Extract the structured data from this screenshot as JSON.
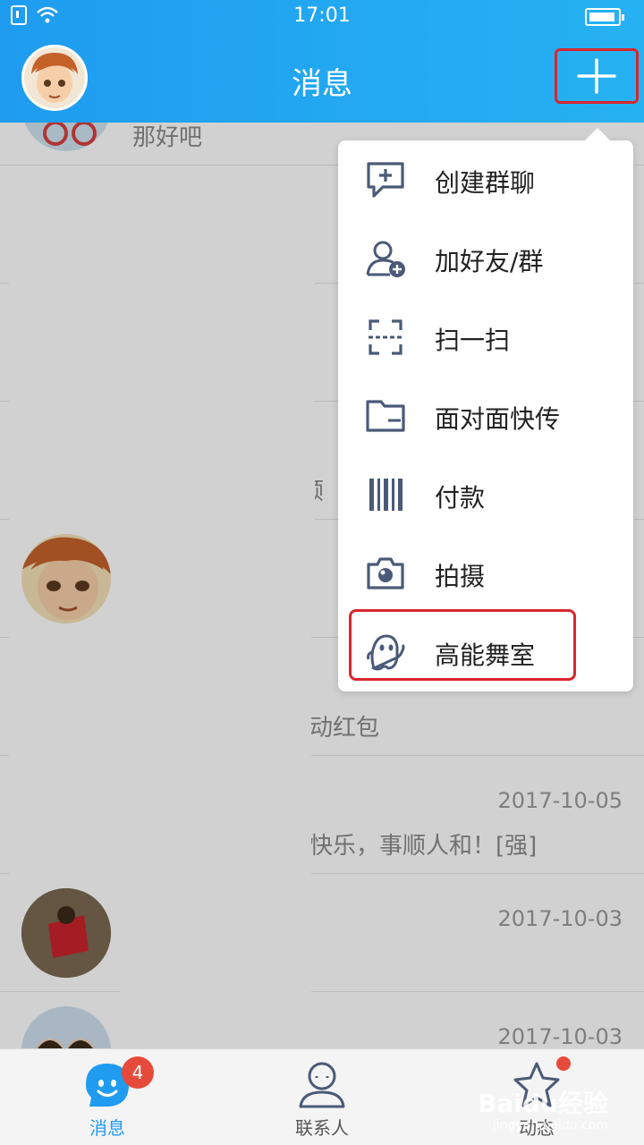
{
  "status_bar": {
    "time": "17:01"
  },
  "header": {
    "title": "消息",
    "add_icon": "plus-icon"
  },
  "rows": [
    {
      "msg": "那好吧"
    },
    {
      "msg": "顺"
    },
    {
      "msg": ""
    },
    {
      "msg": "动红包"
    },
    {
      "time": "2017-10-05",
      "msg": "快乐，事顺人和！[强]"
    },
    {
      "time": "2017-10-03"
    },
    {
      "time": "2017-10-03"
    }
  ],
  "menu": {
    "items": [
      {
        "label": "创建群聊",
        "icon": "group-chat-icon"
      },
      {
        "label": "加好友/群",
        "icon": "add-friend-icon"
      },
      {
        "label": "扫一扫",
        "icon": "scan-icon"
      },
      {
        "label": "面对面快传",
        "icon": "folder-transfer-icon"
      },
      {
        "label": "付款",
        "icon": "barcode-icon"
      },
      {
        "label": "拍摄",
        "icon": "camera-icon"
      },
      {
        "label": "高能舞室",
        "icon": "ghost-icon"
      }
    ]
  },
  "tabs": [
    {
      "label": "消息",
      "badge": "4",
      "icon": "message-icon"
    },
    {
      "label": "联系人",
      "icon": "contact-icon"
    },
    {
      "label": "动态",
      "icon": "star-icon"
    }
  ],
  "watermark": {
    "text": "Baidu经验",
    "url": "jingyan.baidu.com"
  },
  "colors": {
    "header_blue": "#1f9cf0",
    "highlight_red": "#d9262c",
    "badge_red": "#e64a3b"
  }
}
